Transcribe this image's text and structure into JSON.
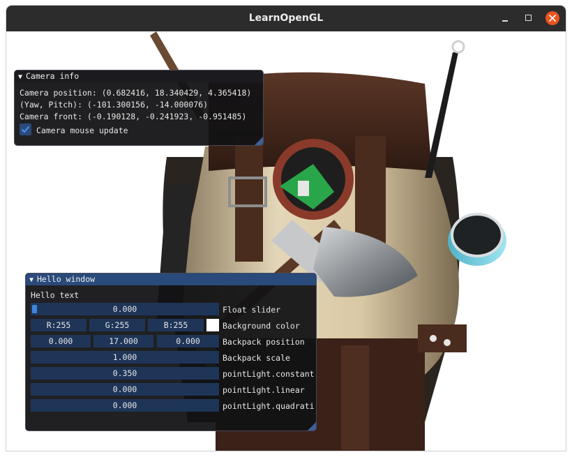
{
  "window": {
    "title": "LearnOpenGL",
    "close_color": "#e95420"
  },
  "camera_panel": {
    "title": "Camera info",
    "position_text": "Camera position: (0.682416, 18.340429, 4.365418)",
    "yaw_pitch_text": "(Yaw, Pitch): (-101.300156, -14.000076)",
    "front_text": "Camera front: (-0.190128, -0.241923, -0.951485)",
    "mouse_update_label": "Camera mouse update",
    "mouse_update_checked": true
  },
  "hello_panel": {
    "title": "Hello window",
    "hello_text": "Hello text",
    "float_slider": {
      "value": "0.000",
      "label": "Float slider"
    },
    "background_color": {
      "r": "R:255",
      "g": "G:255",
      "b": "B:255",
      "label": "Background color",
      "swatch": "#ffffff"
    },
    "backpack_position": {
      "x": "0.000",
      "y": "17.000",
      "z": "0.000",
      "label": "Backpack position"
    },
    "backpack_scale": {
      "value": "1.000",
      "label": "Backpack scale"
    },
    "point_light_constant": {
      "value": "0.350",
      "label": "pointLight.constant"
    },
    "point_light_linear": {
      "value": "0.000",
      "label": "pointLight.linear"
    },
    "point_light_quadratic": {
      "value": "0.000",
      "label": "pointLight.quadrati"
    }
  },
  "colors": {
    "titlebar": "#2c2c2c",
    "imgui_title_active": "#294a7a",
    "imgui_frame": "#1e3558",
    "imgui_accent": "#3d85e0"
  }
}
